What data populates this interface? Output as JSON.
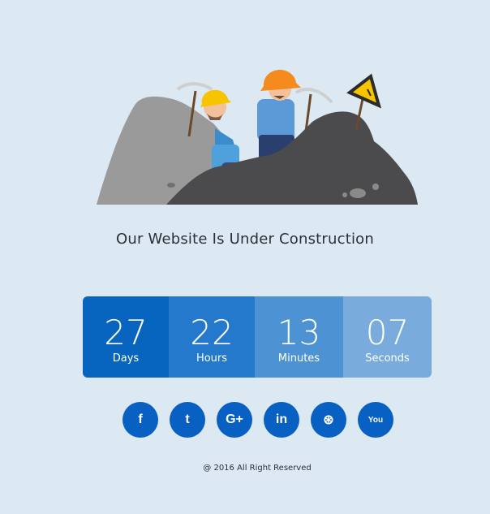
{
  "headline": "Our Website Is Under Construction",
  "countdown": [
    {
      "value": "27",
      "label": "Days"
    },
    {
      "value": "22",
      "label": "Hours"
    },
    {
      "value": "13",
      "label": "Minutes"
    },
    {
      "value": "07",
      "label": "Seconds"
    }
  ],
  "social": [
    {
      "glyph": "f"
    },
    {
      "glyph": "t"
    },
    {
      "glyph": "G+"
    },
    {
      "glyph": "in"
    },
    {
      "glyph": "⊛"
    },
    {
      "glyph": "You"
    }
  ],
  "copyright": "@ 2016 All Right Reserved"
}
